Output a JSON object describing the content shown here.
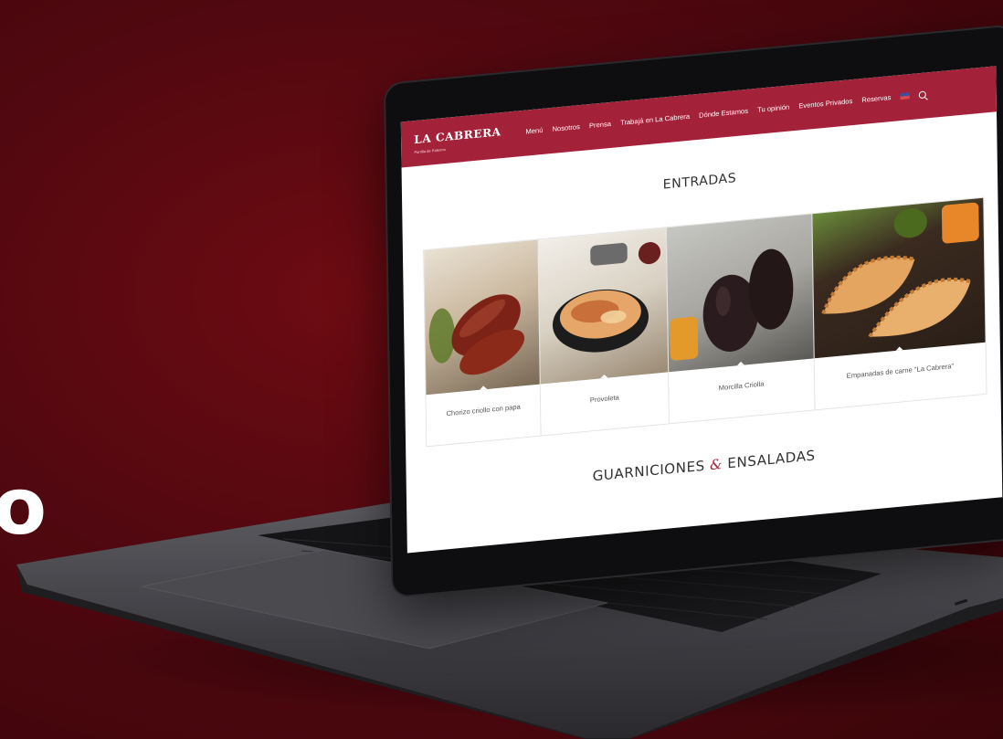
{
  "background_color": "#520810",
  "partial_heading_glyph": "o",
  "site": {
    "logo": "LA CABRERA",
    "logo_tagline": "Parrilla de Palermo",
    "accent_color": "#a4213a",
    "nav": [
      {
        "label": "Menú"
      },
      {
        "label": "Nosotros"
      },
      {
        "label": "Prensa"
      },
      {
        "label": "Trabajá en La Cabrera"
      },
      {
        "label": "Dónde Estamos"
      },
      {
        "label": "Tu opinión"
      },
      {
        "label": "Eventos Privados"
      },
      {
        "label": "Reservas"
      }
    ],
    "language_icon": "us-flag-icon",
    "search_icon": "search-icon",
    "section_entradas": "ENTRADAS",
    "cards": [
      {
        "label": "Chorizo criollo con papa",
        "image": "sausage-photo"
      },
      {
        "label": "Provoleta",
        "image": "provoleta-photo"
      },
      {
        "label": "Morcilla Criolla",
        "image": "morcilla-photo"
      },
      {
        "label": "Empanadas de carne \"La Cabrera\"",
        "image": "empanadas-photo"
      }
    ],
    "section_guarniciones_left": "GUARNICIONES",
    "section_guarniciones_amp": "&",
    "section_guarniciones_right": "ENSALADAS"
  }
}
